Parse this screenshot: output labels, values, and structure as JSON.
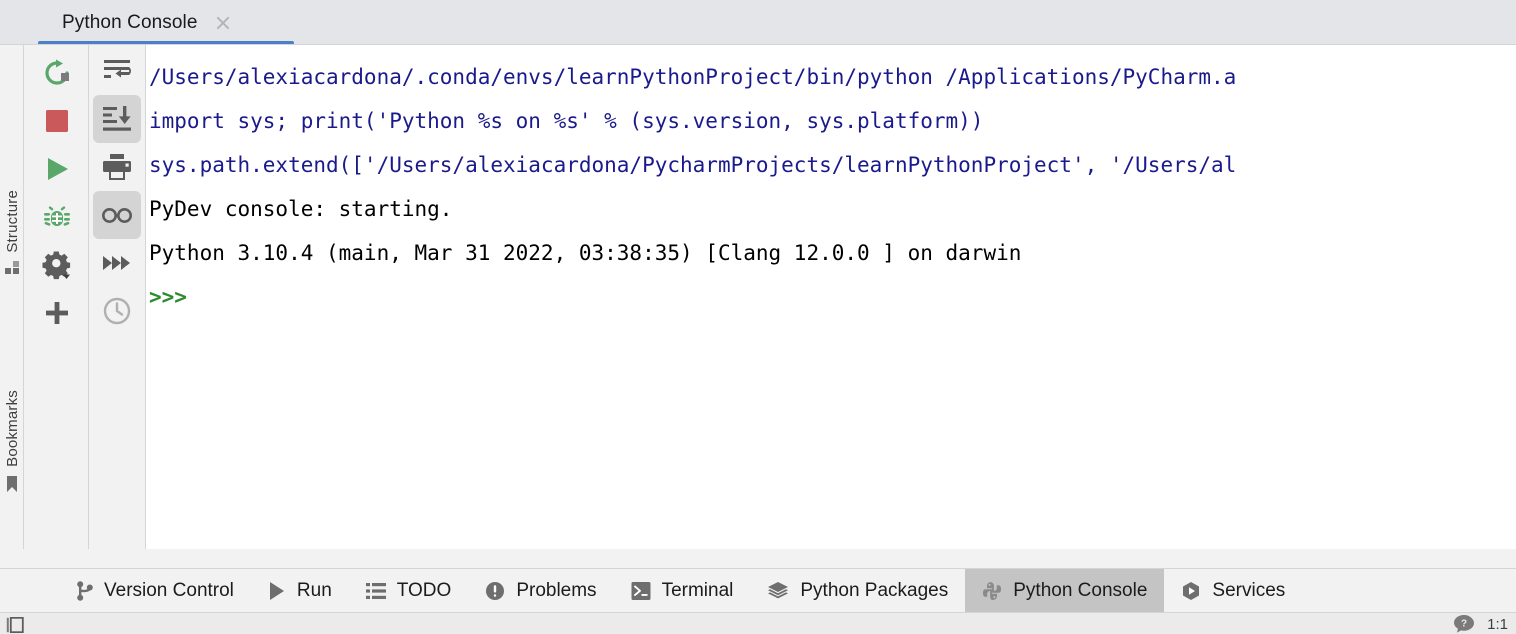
{
  "window": {
    "tab": {
      "title": "Python Console",
      "close_icon": "close-icon"
    }
  },
  "left_rail": {
    "items": [
      {
        "label": "Structure",
        "icon": "structure-icon"
      },
      {
        "label": "Bookmarks",
        "icon": "bookmark-icon"
      }
    ]
  },
  "console_toolbar_primary": {
    "buttons": [
      {
        "name": "rerun-button",
        "icon": "rerun-icon",
        "selected": false
      },
      {
        "name": "stop-button",
        "icon": "stop-icon",
        "selected": false
      },
      {
        "name": "execute-button",
        "icon": "run-icon",
        "selected": false
      },
      {
        "name": "debug-button",
        "icon": "bug-icon",
        "selected": false
      },
      {
        "name": "settings-button",
        "icon": "gear-dropdown-icon",
        "selected": false
      },
      {
        "name": "new-console-button",
        "icon": "plus-icon",
        "selected": false
      }
    ]
  },
  "console_toolbar_secondary": {
    "buttons": [
      {
        "name": "soft-wrap-button",
        "icon": "soft-wrap-icon",
        "selected": false
      },
      {
        "name": "scroll-to-end-button",
        "icon": "scroll-to-end-icon",
        "selected": true
      },
      {
        "name": "print-button",
        "icon": "print-icon",
        "selected": false
      },
      {
        "name": "show-variables-button",
        "icon": "glasses-icon",
        "selected": true
      },
      {
        "name": "execute-multiline-button",
        "icon": "fast-forward-icon",
        "selected": false
      },
      {
        "name": "command-history-button",
        "icon": "clock-icon",
        "selected": false
      }
    ]
  },
  "console": {
    "lines": [
      {
        "text": "/Users/alexiacardona/.conda/envs/learnPythonProject/bin/python /Applications/PyCharm.a",
        "color": "blue"
      },
      {
        "text": "",
        "color": "blank"
      },
      {
        "text": "import sys; print('Python %s on %s' % (sys.version, sys.platform))",
        "color": "blue"
      },
      {
        "text": "sys.path.extend(['/Users/alexiacardona/PycharmProjects/learnPythonProject', '/Users/al",
        "color": "blue"
      },
      {
        "text": "",
        "color": "blank"
      },
      {
        "text": "PyDev console: starting.",
        "color": "black"
      },
      {
        "text": "",
        "color": "blank"
      },
      {
        "text": "Python 3.10.4 (main, Mar 31 2022, 03:38:35) [Clang 12.0.0 ] on darwin",
        "color": "black"
      },
      {
        "text": "",
        "color": "blank"
      },
      {
        "text": ">>>",
        "color": "green"
      }
    ]
  },
  "bottom_bar": {
    "items": [
      {
        "label": "Version Control",
        "icon": "branch-icon",
        "active": false
      },
      {
        "label": "Run",
        "icon": "run-triangle-icon",
        "active": false
      },
      {
        "label": "TODO",
        "icon": "list-icon",
        "active": false
      },
      {
        "label": "Problems",
        "icon": "exclamation-circle-icon",
        "active": false
      },
      {
        "label": "Terminal",
        "icon": "terminal-icon",
        "active": false
      },
      {
        "label": "Python Packages",
        "icon": "layers-icon",
        "active": false
      },
      {
        "label": "Python Console",
        "icon": "python-icon",
        "active": true
      },
      {
        "label": "Services",
        "icon": "play-hex-icon",
        "active": false
      }
    ]
  },
  "status_bar": {
    "left_icon": "tool-window-toggle-icon",
    "help_icon": "help-icon",
    "position": "1:1"
  },
  "colors": {
    "tabstrip_bg": "#e3e5e8",
    "tab_underline": "#4a80c6",
    "panel_bg": "#f2f2f2",
    "console_bg": "#ffffff",
    "console_blue": "#1a1a8c",
    "console_green": "#2e8b2e",
    "active_tool_bg": "#c4c4c4",
    "selected_button_bg": "#d4d4d4",
    "icon_green": "#59a869",
    "icon_red": "#c9595b",
    "icon_gray": "#6e6e6e"
  }
}
